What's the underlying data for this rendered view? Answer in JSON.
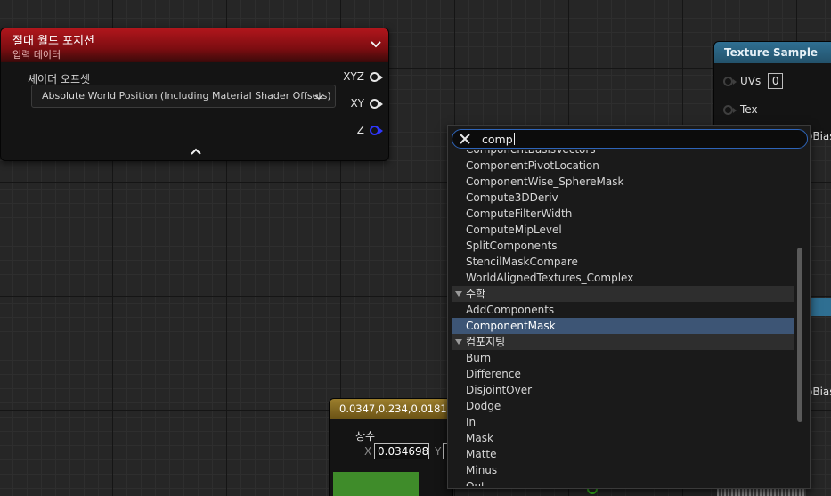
{
  "awp_node": {
    "title": "절대 월드 포지션",
    "subtitle": "입력 데이터",
    "property_label": "셰이더 오프셋",
    "combo_value": "Absolute World Position (Including Material Shader Offsets)",
    "outputs": [
      "XYZ",
      "XY",
      "Z"
    ],
    "header_color": "#9f1419"
  },
  "texture_node": {
    "title": "Texture Sample",
    "inputs": [
      {
        "label": "UVs",
        "value": "0"
      },
      {
        "label": "Tex"
      }
    ],
    "header_color": "#2f6f92"
  },
  "right_fragments": [
    "oBias",
    "oBias"
  ],
  "const_node": {
    "title": "0.0347,0.234,0.0181",
    "subtitle": "상수",
    "x_label": "X",
    "x_value": "0.034698",
    "y_label": "Y",
    "header_color": "#8a6e24",
    "preview_color": "#3f8c2a"
  },
  "search": {
    "query": "comp",
    "selected_color": "#3d5575",
    "border_color": "#2e64b8",
    "items": [
      {
        "type": "item",
        "label": "ComponentBasisVectors"
      },
      {
        "type": "item",
        "label": "ComponentPivotLocation"
      },
      {
        "type": "item",
        "label": "ComponentWise_SphereMask"
      },
      {
        "type": "item",
        "label": "Compute3DDeriv"
      },
      {
        "type": "item",
        "label": "ComputeFilterWidth"
      },
      {
        "type": "item",
        "label": "ComputeMipLevel"
      },
      {
        "type": "item",
        "label": "SplitComponents"
      },
      {
        "type": "item",
        "label": "StencilMaskCompare"
      },
      {
        "type": "item",
        "label": "WorldAlignedTextures_Complex"
      },
      {
        "type": "cat",
        "label": "수학"
      },
      {
        "type": "item",
        "label": "AddComponents"
      },
      {
        "type": "item",
        "label": "ComponentMask",
        "selected": true
      },
      {
        "type": "cat",
        "label": "컴포지팅"
      },
      {
        "type": "item",
        "label": "Burn"
      },
      {
        "type": "item",
        "label": "Difference"
      },
      {
        "type": "item",
        "label": "DisjointOver"
      },
      {
        "type": "item",
        "label": "Dodge"
      },
      {
        "type": "item",
        "label": "In"
      },
      {
        "type": "item",
        "label": "Mask"
      },
      {
        "type": "item",
        "label": "Matte"
      },
      {
        "type": "item",
        "label": "Minus"
      },
      {
        "type": "item",
        "label": "Out"
      }
    ]
  },
  "icons": {
    "collapse": "chevron-down-icon",
    "expand": "chevron-up-icon",
    "clear": "close-icon",
    "combo": "chevron-down-icon"
  }
}
